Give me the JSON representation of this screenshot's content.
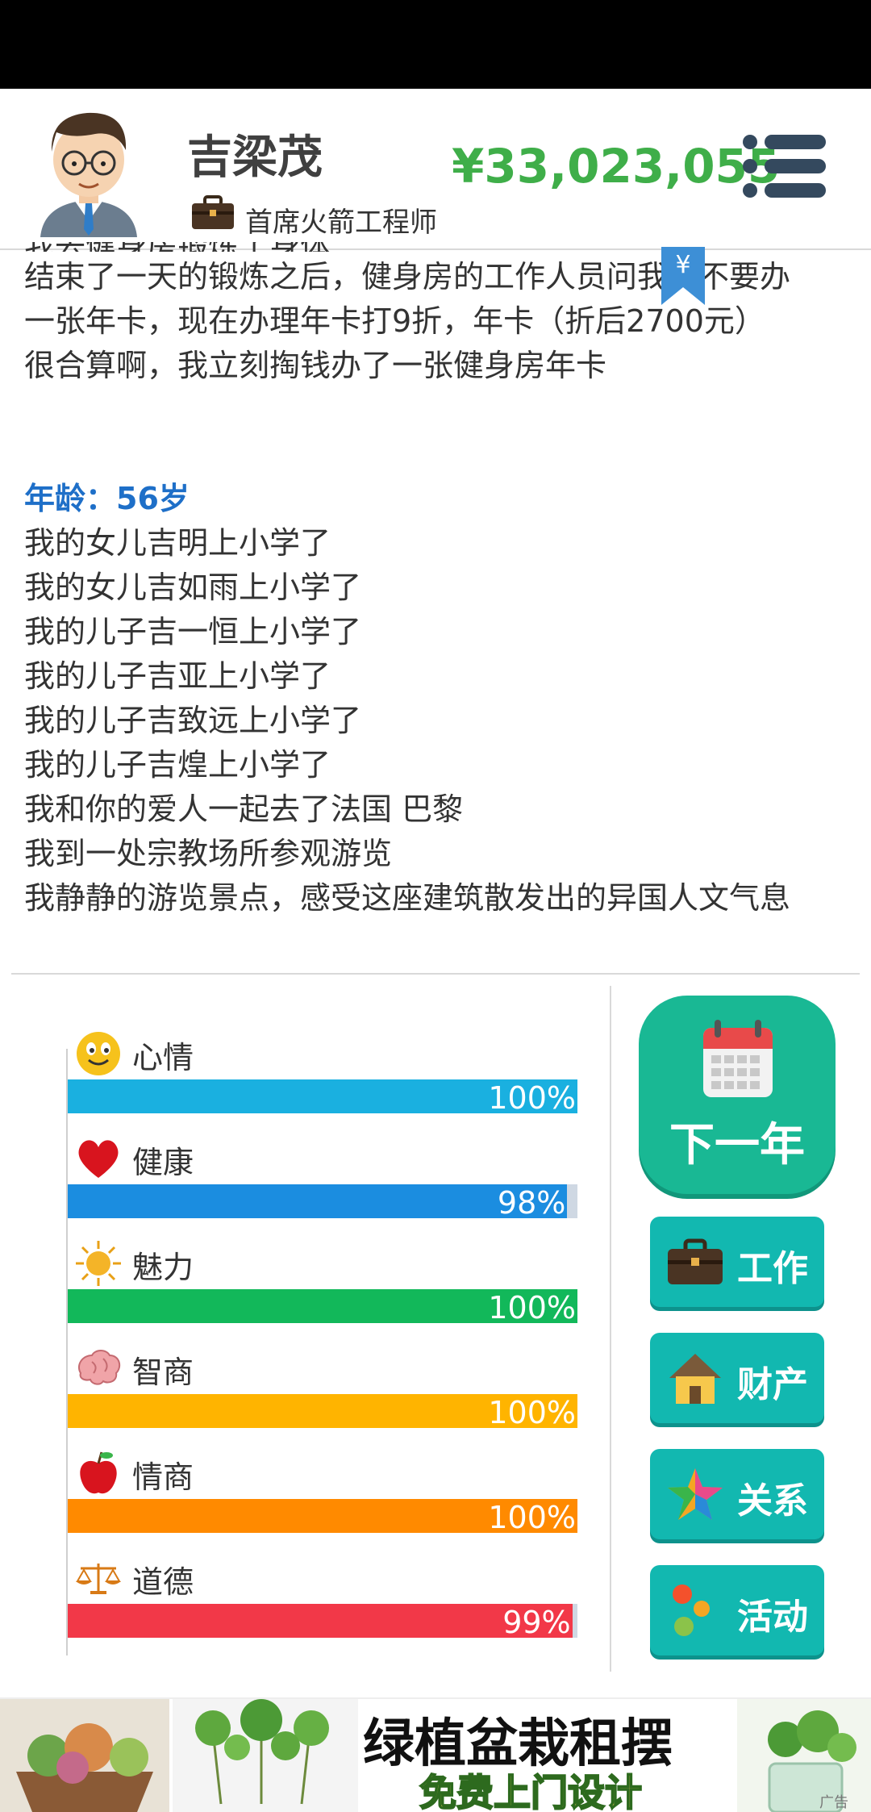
{
  "header": {
    "name": "吉梁茂",
    "job": "首席火箭工程师",
    "money": "¥33,023,055"
  },
  "log": {
    "cut_line": "我去健身房锻炼了身体",
    "lines_before": [
      "结束了一天的锻炼之后，健身房的工作人员问我要不要办",
      "一张年卡，现在办理年卡打9折，年卡（折后2700元）",
      "很合算啊，我立刻掏钱办了一张健身房年卡"
    ],
    "age_label": "年龄：56岁",
    "lines_after": [
      "我的女儿吉明上小学了",
      "我的女儿吉如雨上小学了",
      "我的儿子吉一恒上小学了",
      "我的儿子吉亚上小学了",
      "我的儿子吉致远上小学了",
      "我的儿子吉煌上小学了",
      "我和你的爱人一起去了法国 巴黎",
      "我到一处宗教场所参观游览",
      "我静静的游览景点，感受这座建筑散发出的异国人文气息"
    ],
    "bookmark_symbol": "¥"
  },
  "stats": [
    {
      "label": "心情",
      "value": 100,
      "pct": "100%",
      "color": "#1ab0e0",
      "icon": "smiley-icon"
    },
    {
      "label": "健康",
      "value": 98,
      "pct": "98%",
      "color": "#1b8de0",
      "icon": "heart-icon"
    },
    {
      "label": "魅力",
      "value": 100,
      "pct": "100%",
      "color": "#12b85a",
      "icon": "sun-icon"
    },
    {
      "label": "智商",
      "value": 100,
      "pct": "100%",
      "color": "#ffb400",
      "icon": "brain-icon"
    },
    {
      "label": "情商",
      "value": 100,
      "pct": "100%",
      "color": "#ff8a00",
      "icon": "apple-icon"
    },
    {
      "label": "道德",
      "value": 99,
      "pct": "99%",
      "color": "#f23848",
      "icon": "scales-icon"
    }
  ],
  "actions": {
    "next_year": "下一年",
    "work": "工作",
    "property": "财产",
    "relations": "关系",
    "activity": "活动"
  },
  "ad": {
    "title": "绿植盆栽租摆",
    "subtitle": "免费上门设计",
    "corner": "广告"
  }
}
